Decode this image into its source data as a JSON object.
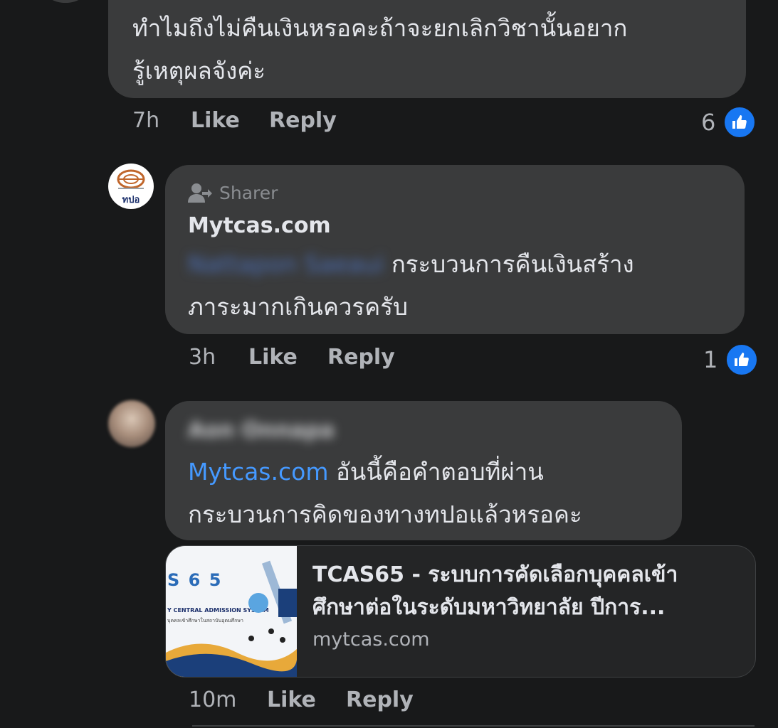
{
  "comment1": {
    "text_line1": "ทำไมถึงไม่คืนเงินหรอคะถ้าจะยกเลิกวิชานั้นอยาก",
    "text_line2": "รู้เหตุผลจังค่ะ",
    "time": "7h",
    "like_label": "Like",
    "reply_label": "Reply",
    "reaction_count": "6"
  },
  "comment2": {
    "avatar_text": "ทปอ",
    "badge": "Sharer",
    "author": "Mytcas.com",
    "mention": "Nattapon Saeaui",
    "text_line1": "กระบวนการคืนเงินสร้าง",
    "text_line2": "ภาระมากเกินควรครับ",
    "time": "3h",
    "like_label": "Like",
    "reply_label": "Reply",
    "reaction_count": "1"
  },
  "comment3": {
    "author": "Aon Onnapa",
    "mention": "Mytcas.com",
    "text_line1": "อันนี้คือคำตอบที่ผ่าน",
    "text_line2": "กระบวนการคิดของทางทปอแล้วหรอคะ",
    "time": "10m",
    "like_label": "Like",
    "reply_label": "Reply"
  },
  "link_preview": {
    "title_line1": "TCAS65 - ระบบการคัดเลือกบุคคลเข้า",
    "title_line2": "ศึกษาต่อในระดับมหาวิทยาลัย ปีการ...",
    "domain": "mytcas.com",
    "thumb_badge": "S 6 5",
    "thumb_caption": "Y CENTRAL ADMISSION SYSTEM",
    "thumb_subcaption": "บุคคลเข้าศึกษาในสถาบันอุดมศึกษา"
  },
  "colors": {
    "background": "#18191a",
    "bubble": "#3a3b3c",
    "link": "#4599ff",
    "like_blue": "#1877f2"
  }
}
